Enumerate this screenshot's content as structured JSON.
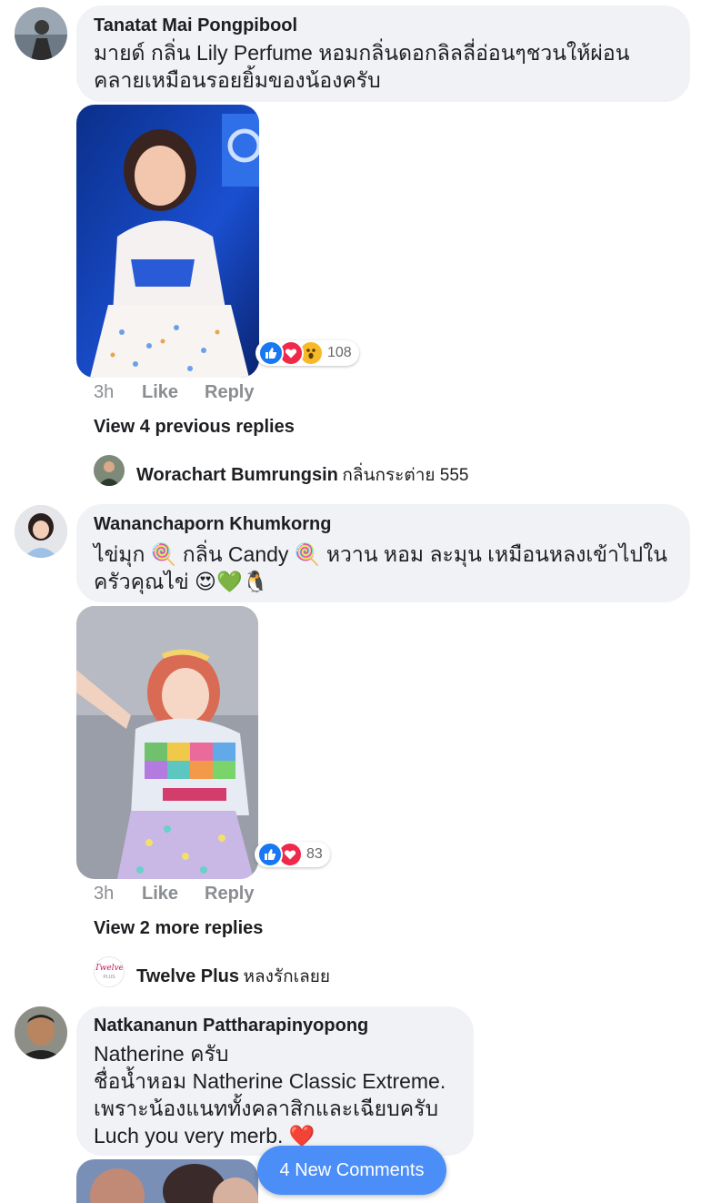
{
  "comments": [
    {
      "author": "Tanatat Mai Pongpibool",
      "lines": [
        "มายด์ กลิ่น Lily Perfume หอมกลิ่นดอกลิลลี่อ่อนๆชวนให้ผ่อน",
        "คลายเหมือนรอยยิ้มของน้องครับ"
      ],
      "reaction_count": "108",
      "reaction_icons": [
        "like-icon",
        "love-icon",
        "wow-icon"
      ],
      "time": "3h",
      "like_label": "Like",
      "reply_label": "Reply",
      "view_more": "View 4 previous replies",
      "latest_reply": {
        "author": "Worachart Bumrungsin",
        "text": "กลิ่นกระต่าย 555"
      }
    },
    {
      "author": "Wananchaporn Khumkorng",
      "lines": [
        "ไข่มุก 🍭 กลิ่น Candy 🍭 หวาน หอม ละมุน เหมือนหลงเข้าไปใน",
        "ครัวคุณไข่ 😍💚🐧"
      ],
      "reaction_count": "83",
      "reaction_icons": [
        "like-icon",
        "love-icon"
      ],
      "time": "3h",
      "like_label": "Like",
      "reply_label": "Reply",
      "view_more": "View 2 more replies",
      "latest_reply": {
        "author": "Twelve Plus",
        "text": "หลงรักเลยย",
        "avatar_text": "Twelve",
        "avatar_subtext": "PLUS"
      }
    },
    {
      "author": "Natkananun Pattharapinyopong",
      "lines": [
        "Natherine ครับ",
        "ชื่อน้ำหอม Natherine Classic Extreme.",
        "เพราะน้องแนททั้งคลาสิกและเฉียบครับ",
        "Luch you very merb. ❤️"
      ]
    }
  ],
  "new_comments_label": "4 New Comments",
  "colors": {
    "bubble": "#f0f2f5",
    "like": "#1877f2",
    "love": "#f0284a",
    "wow": "#f7b928",
    "new_comments_button": "#4b8ef7",
    "meta_text": "#8a8d91"
  }
}
